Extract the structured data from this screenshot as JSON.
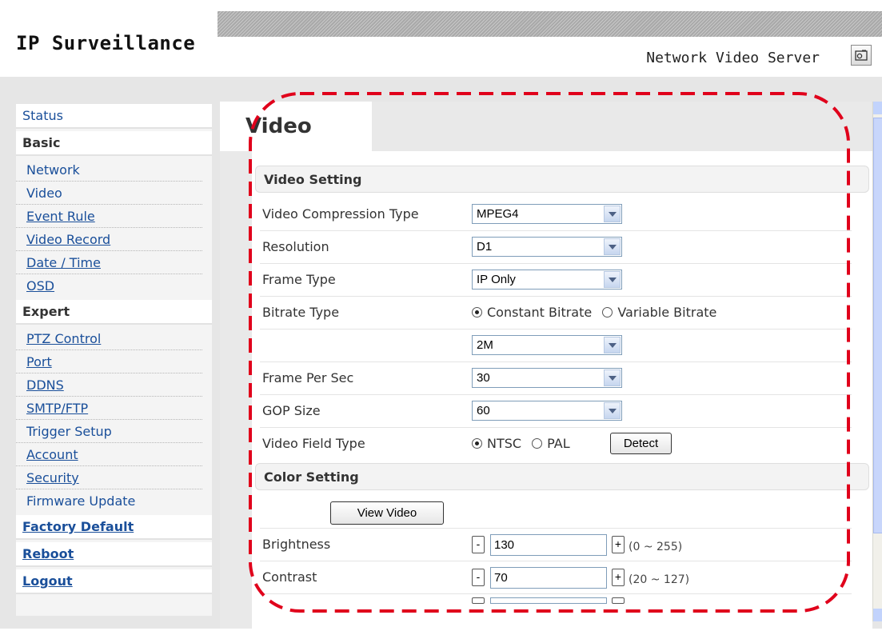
{
  "header": {
    "brand": "IP Surveillance",
    "product": "Network Video Server",
    "camera_icon": "camera-icon"
  },
  "sidebar": {
    "status": "Status",
    "basic": "Basic",
    "basic_items": [
      "Network",
      "Video",
      "Event Rule",
      "Video Record",
      "Date / Time",
      "OSD"
    ],
    "expert": "Expert",
    "expert_items": [
      "PTZ Control",
      "Port",
      "DDNS",
      "SMTP/FTP",
      "Trigger Setup",
      "Account",
      "Security",
      "Firmware Update"
    ],
    "factory_default": "Factory Default",
    "reboot": "Reboot",
    "logout": "Logout"
  },
  "page": {
    "title": "Video"
  },
  "video_setting": {
    "heading": "Video Setting",
    "compression_label": "Video Compression Type",
    "compression_value": "MPEG4",
    "resolution_label": "Resolution",
    "resolution_value": "D1",
    "frame_type_label": "Frame Type",
    "frame_type_value": "IP Only",
    "bitrate_type_label": "Bitrate Type",
    "bitrate_constant": "Constant Bitrate",
    "bitrate_variable": "Variable Bitrate",
    "bitrate_value": "2M",
    "fps_label": "Frame Per Sec",
    "fps_value": "30",
    "gop_label": "GOP Size",
    "gop_value": "60",
    "field_type_label": "Video Field Type",
    "field_ntsc": "NTSC",
    "field_pal": "PAL",
    "detect_button": "Detect"
  },
  "color_setting": {
    "heading": "Color Setting",
    "view_video_button": "View Video",
    "brightness_label": "Brightness",
    "brightness_value": "130",
    "brightness_range": "(0 ~ 255)",
    "contrast_label": "Contrast",
    "contrast_value": "70",
    "contrast_range": "(20 ~ 127)",
    "minus": "-",
    "plus": "+"
  },
  "colors": {
    "highlight": "#e0001b",
    "link": "#1a4f9a"
  }
}
